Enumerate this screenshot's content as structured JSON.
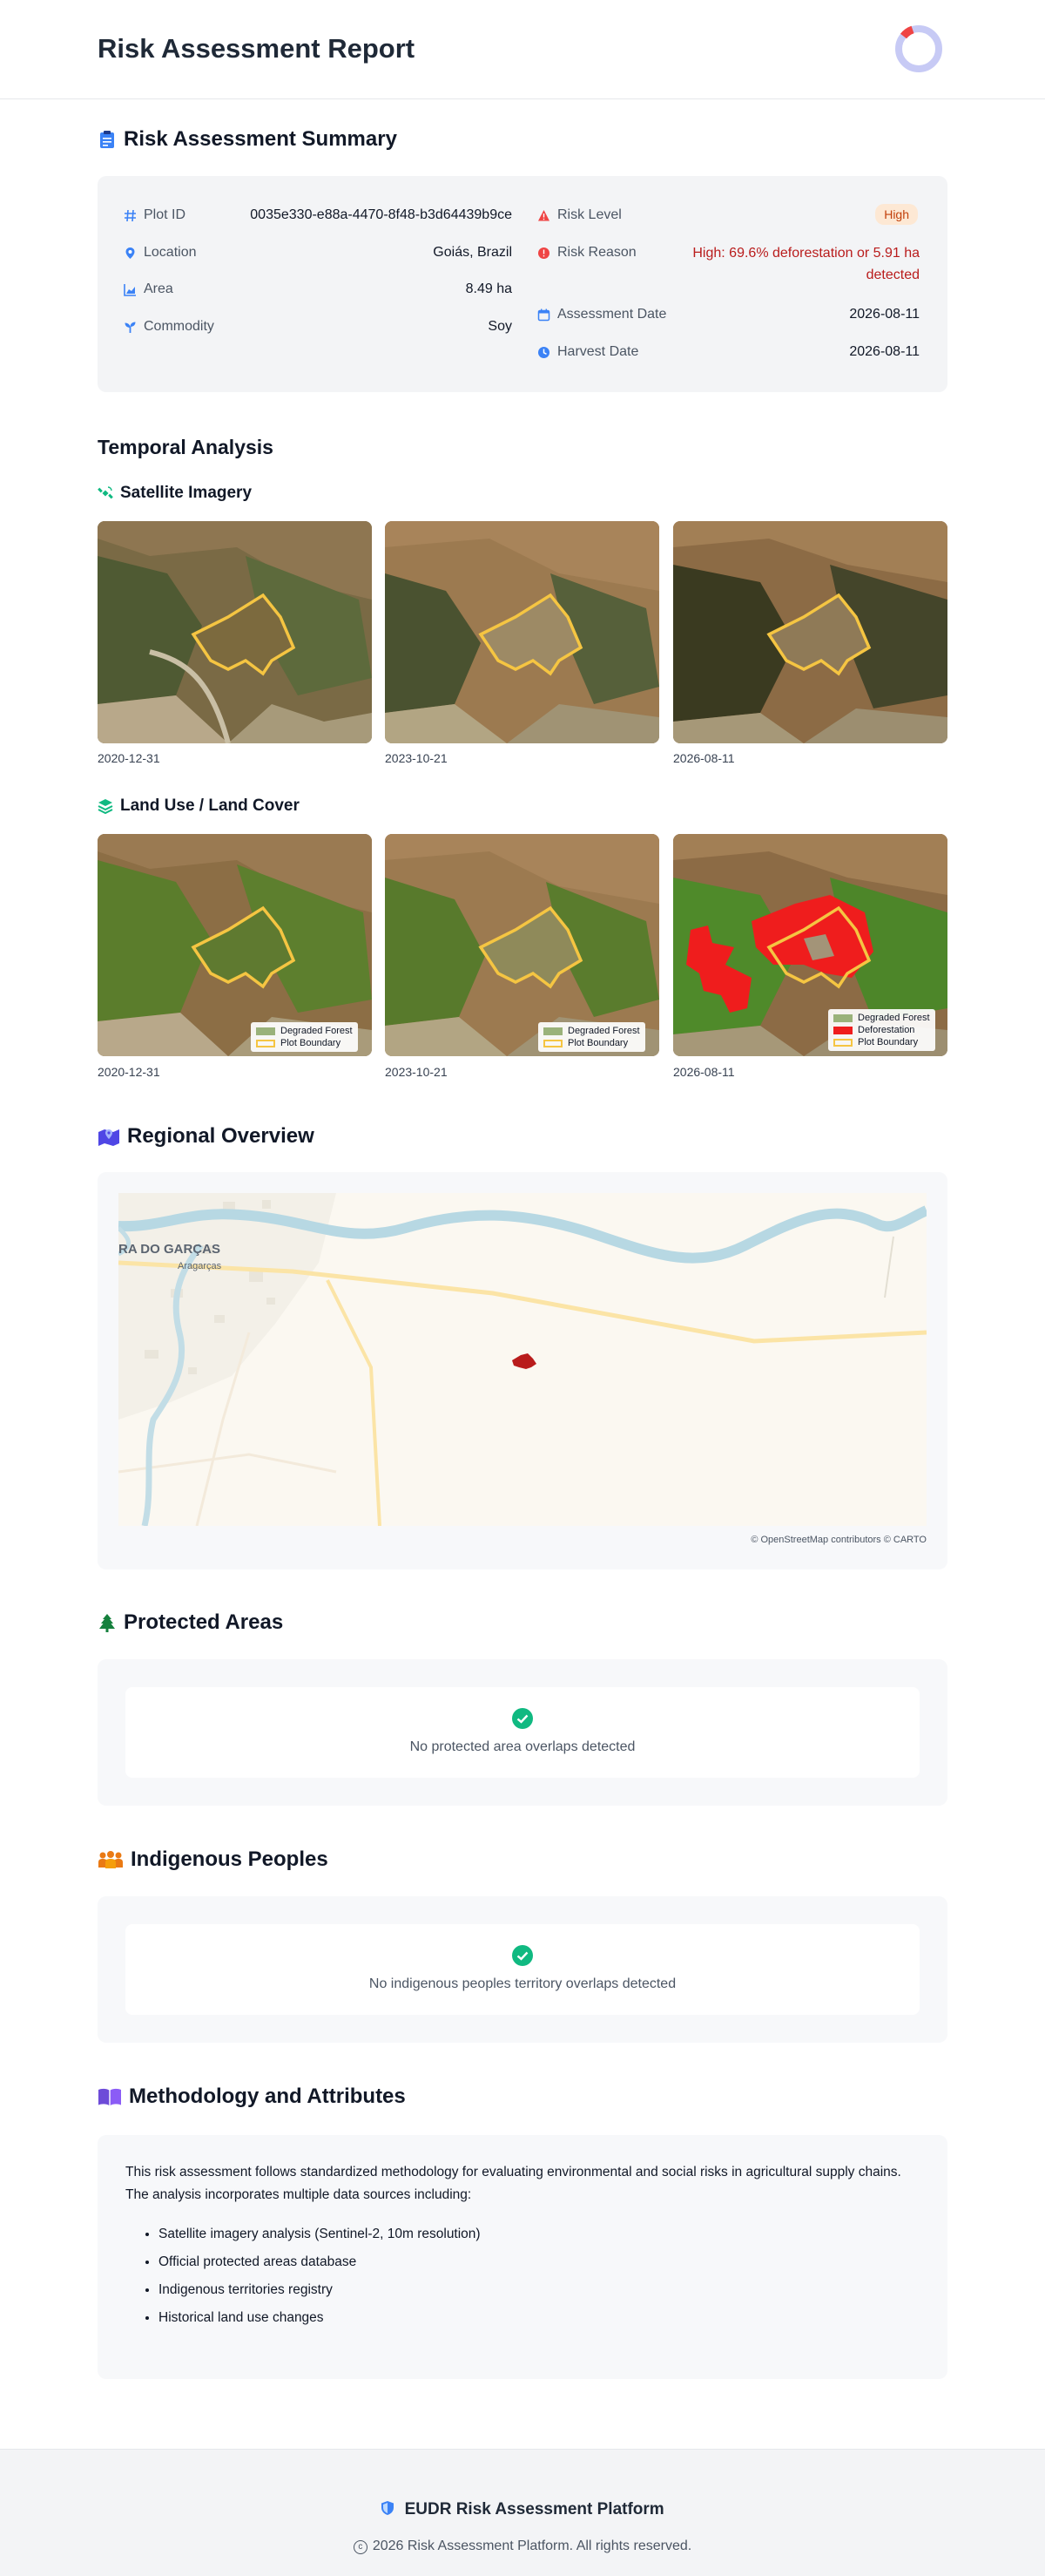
{
  "header": {
    "title": "Risk Assessment Report"
  },
  "summary": {
    "title": "Risk Assessment Summary",
    "left": [
      {
        "label": "Plot ID",
        "value": "0035e330-e88a-4470-8f48-b3d64439b9ce",
        "icon": "hash-icon"
      },
      {
        "label": "Location",
        "value": "Goiás, Brazil",
        "icon": "map-pin-icon"
      },
      {
        "label": "Area",
        "value": "8.49 ha",
        "icon": "chart-area-icon"
      },
      {
        "label": "Commodity",
        "value": "Soy",
        "icon": "seedling-icon"
      }
    ],
    "risk_level_label": "Risk Level",
    "risk_level_value": "High",
    "risk_reason_label": "Risk Reason",
    "risk_reason_value": "High: 69.6% deforestation or 5.91 ha detected",
    "assessment_date_label": "Assessment Date",
    "assessment_date_value": "2026-08-11",
    "harvest_date_label": "Harvest Date",
    "harvest_date_value": "2026-08-11"
  },
  "temporal": {
    "title": "Temporal Analysis",
    "satellite_title": "Satellite Imagery",
    "landuse_title": "Land Use / Land Cover",
    "dates": [
      "2020-12-31",
      "2023-10-21",
      "2026-08-11"
    ],
    "legend": {
      "degraded": "Degraded Forest",
      "deforestation": "Deforestation",
      "boundary": "Plot Boundary"
    }
  },
  "regional": {
    "title": "Regional Overview",
    "place_label": "RA DO GARÇAS",
    "place_sublabel": "Aragarças",
    "attribution": "© OpenStreetMap contributors © CARTO"
  },
  "protected": {
    "title": "Protected Areas",
    "message": "No protected area overlaps detected"
  },
  "indigenous": {
    "title": "Indigenous Peoples",
    "message": "No indigenous peoples territory overlaps detected"
  },
  "methodology": {
    "title": "Methodology and Attributes",
    "intro": "This risk assessment follows standardized methodology for evaluating environmental and social risks in agricultural supply chains. The analysis incorporates multiple data sources including:",
    "items": [
      "Satellite imagery analysis (Sentinel-2, 10m resolution)",
      "Official protected areas database",
      "Indigenous territories registry",
      "Historical land use changes"
    ]
  },
  "footer": {
    "title": "EUDR Risk Assessment Platform",
    "copyright": "2026 Risk Assessment Platform. All rights reserved."
  },
  "colors": {
    "accent": "#3b82f6",
    "risk_high": "#b91c1c",
    "success": "#10b981",
    "deforestation": "#ef1d1d",
    "degraded": "#9ab27a",
    "boundary": "#f5c542"
  }
}
